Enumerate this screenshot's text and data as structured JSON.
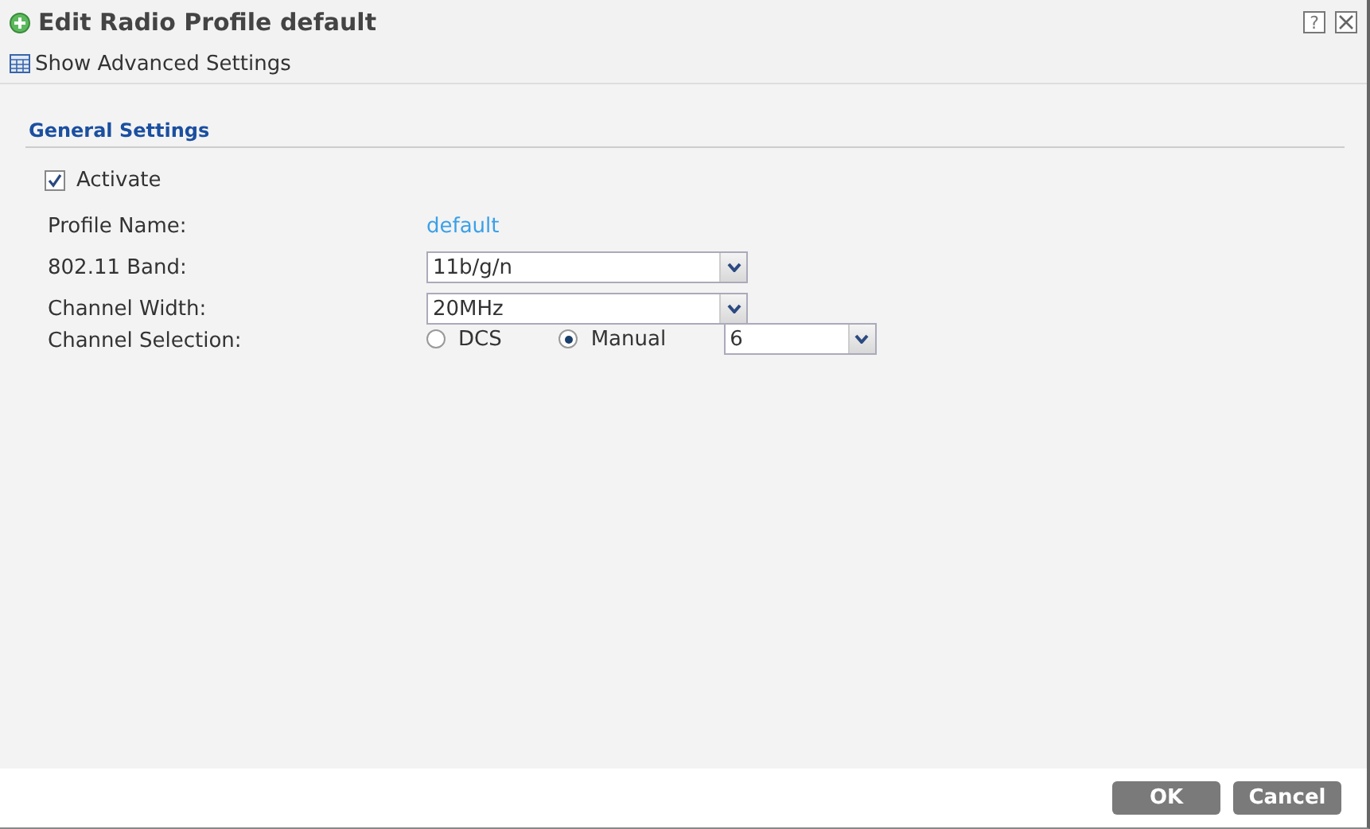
{
  "window": {
    "title": "Edit Radio Profile default",
    "help": "?"
  },
  "toolbar": {
    "label": "Show Advanced Settings"
  },
  "section": {
    "title": "General Settings"
  },
  "activate": {
    "label": "Activate",
    "checked": true
  },
  "fields": [
    {
      "kind": "text",
      "label": "Profile Name:",
      "value": "default"
    },
    {
      "kind": "select",
      "label": "802.11 Band:",
      "value": "11b/g/n"
    },
    {
      "kind": "select",
      "label": "Channel Width:",
      "value": "20MHz"
    },
    {
      "kind": "radios",
      "label": "Channel Selection:",
      "options": [
        {
          "label": "DCS",
          "selected": false
        },
        {
          "label": "Manual",
          "selected": true
        }
      ],
      "value": "6"
    }
  ],
  "buttons": [
    "OK",
    "Cancel"
  ]
}
